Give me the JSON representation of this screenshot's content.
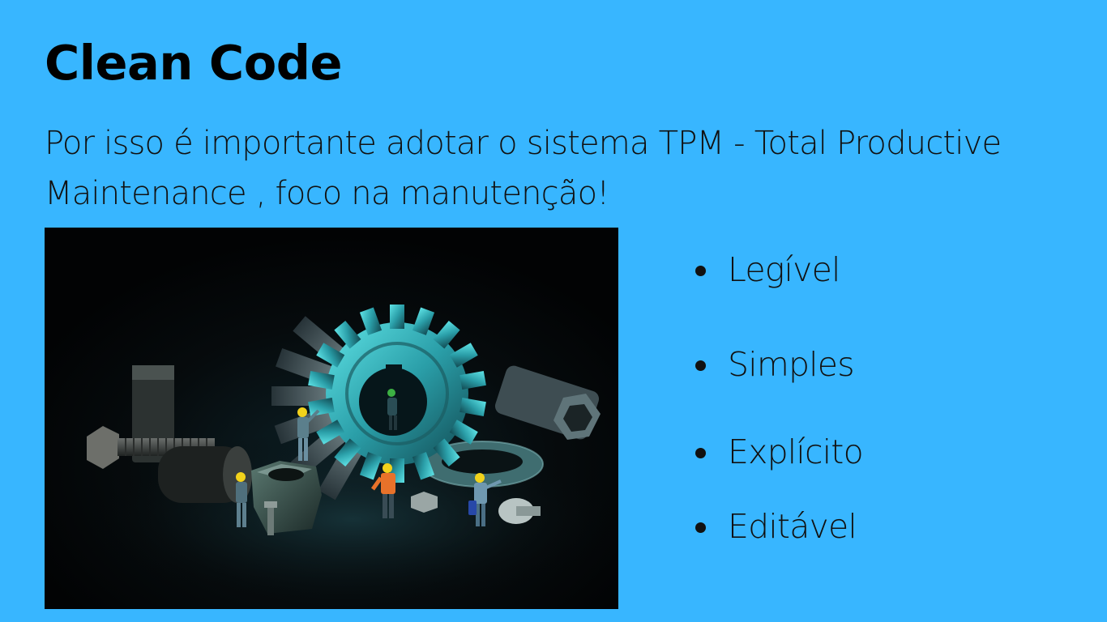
{
  "slide": {
    "title": "Clean Code",
    "subtitle": "Por isso é importante adotar o sistema TPM - Total Productive Maintenance , foco na manutenção!",
    "background_color": "#38B6FF",
    "photo_icon": "gear-workers-photo",
    "bullets": [
      "Legível",
      "Simples",
      "Explícito",
      "Editável"
    ]
  }
}
